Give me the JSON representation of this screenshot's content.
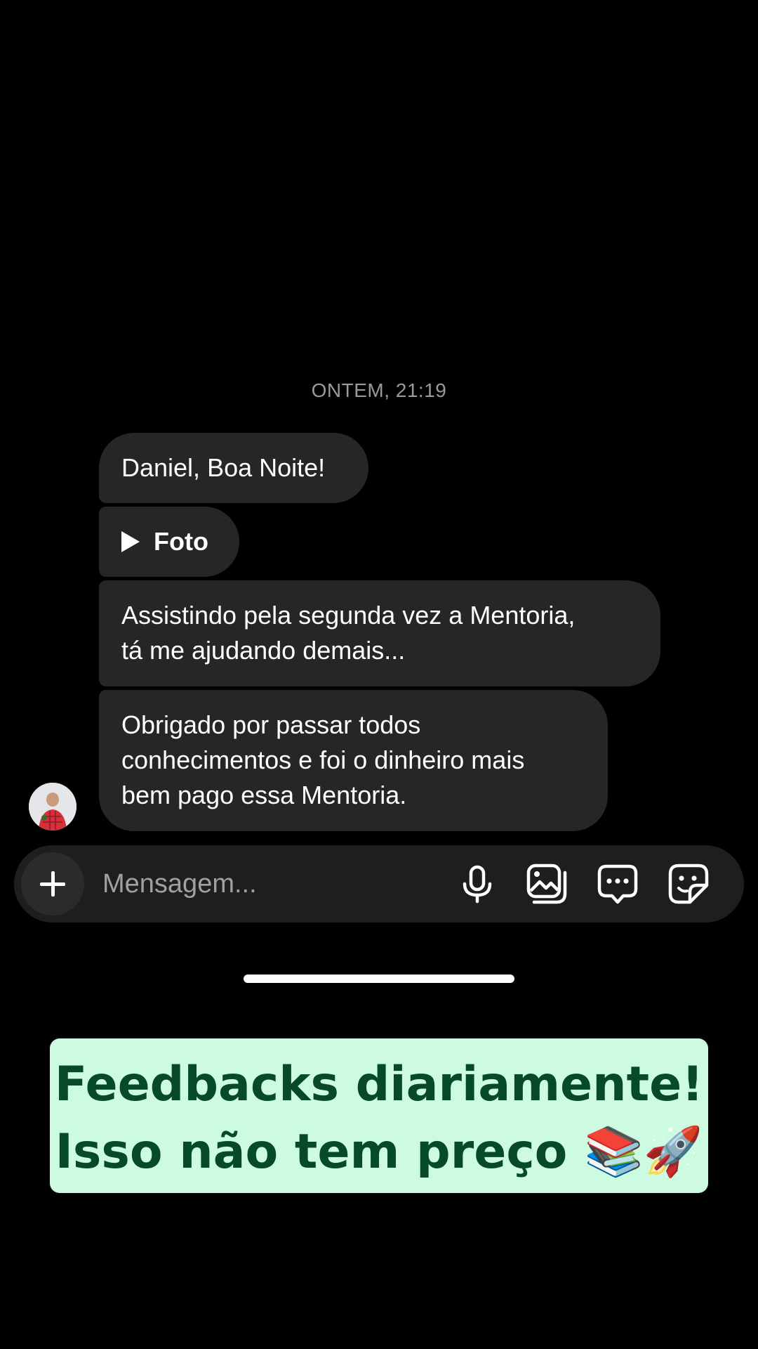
{
  "chat": {
    "timestamp": "ONTEM, 21:19",
    "messages": [
      "Daniel, Boa Noite!",
      "Foto",
      "Assistindo pela segunda vez a Mentoria,\ntá me ajudando demais...",
      "Obrigado por passar todos\nconhecimentos e foi o dinheiro mais\nbem pago essa Mentoria."
    ]
  },
  "composer": {
    "placeholder": "Mensagem...",
    "icons": [
      "plus-icon",
      "microphone-icon",
      "gallery-icon",
      "chat-bubble-icon",
      "sticker-icon"
    ]
  },
  "promo": {
    "line1": "Feedbacks diariamente!",
    "line2": "Isso não tem preço 📚🚀"
  },
  "colors": {
    "background": "#000000",
    "bubble": "#262626",
    "composer": "#1e1e1e",
    "promo_bg": "#cdfbe1",
    "promo_text": "#064a2b"
  }
}
